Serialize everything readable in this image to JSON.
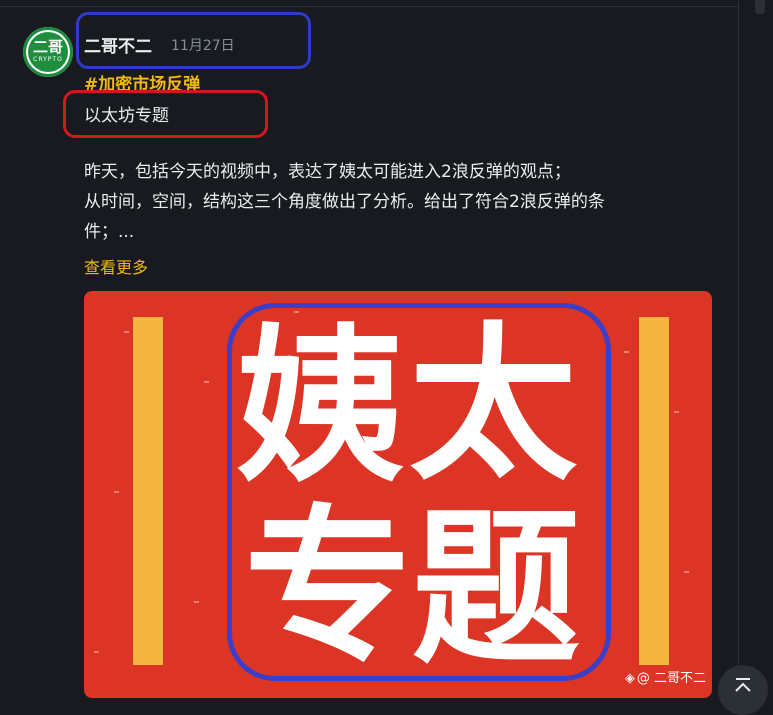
{
  "post": {
    "avatar_text": "二哥",
    "avatar_subtext": "CRYPTO",
    "author": "二哥不二",
    "date": "11月27日",
    "hashtag": "#加密市场反弹",
    "topic": "以太坊专题",
    "body_line1": "昨天，包括今天的视频中，表达了姨太可能进入2浪反弹的观点；",
    "body_line2": "从时间，空间，结构这三个角度做出了分析。给出了符合2浪反弹的条",
    "body_line3": "件；...",
    "see_more": "查看更多"
  },
  "image": {
    "char1": "姨",
    "char2": "太",
    "char3": "专",
    "char4": "题",
    "watermark_icon": "binance-icon",
    "watermark": "@ 二哥不二",
    "background_color": "#dc3526",
    "bar_color": "#f4b63f"
  },
  "annotations": {
    "author_box_color": "#2d3acb",
    "topic_box_color": "#d4171e"
  },
  "controls": {
    "scroll_top_icon": "arrow-up-icon"
  }
}
